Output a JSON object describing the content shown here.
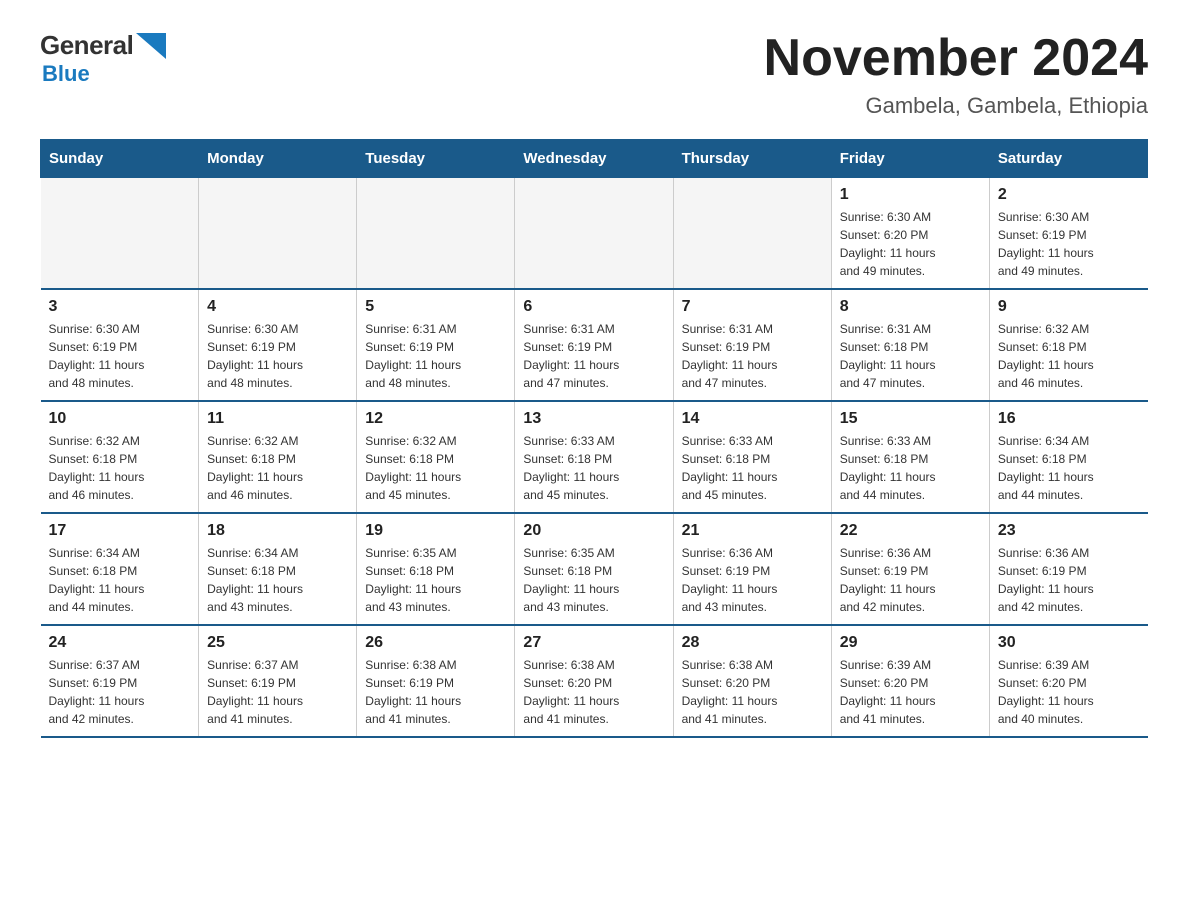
{
  "header": {
    "logo_general": "General",
    "logo_blue": "Blue",
    "title": "November 2024",
    "subtitle": "Gambela, Gambela, Ethiopia"
  },
  "weekdays": [
    "Sunday",
    "Monday",
    "Tuesday",
    "Wednesday",
    "Thursday",
    "Friday",
    "Saturday"
  ],
  "weeks": [
    [
      {
        "day": "",
        "info": ""
      },
      {
        "day": "",
        "info": ""
      },
      {
        "day": "",
        "info": ""
      },
      {
        "day": "",
        "info": ""
      },
      {
        "day": "",
        "info": ""
      },
      {
        "day": "1",
        "info": "Sunrise: 6:30 AM\nSunset: 6:20 PM\nDaylight: 11 hours\nand 49 minutes."
      },
      {
        "day": "2",
        "info": "Sunrise: 6:30 AM\nSunset: 6:19 PM\nDaylight: 11 hours\nand 49 minutes."
      }
    ],
    [
      {
        "day": "3",
        "info": "Sunrise: 6:30 AM\nSunset: 6:19 PM\nDaylight: 11 hours\nand 48 minutes."
      },
      {
        "day": "4",
        "info": "Sunrise: 6:30 AM\nSunset: 6:19 PM\nDaylight: 11 hours\nand 48 minutes."
      },
      {
        "day": "5",
        "info": "Sunrise: 6:31 AM\nSunset: 6:19 PM\nDaylight: 11 hours\nand 48 minutes."
      },
      {
        "day": "6",
        "info": "Sunrise: 6:31 AM\nSunset: 6:19 PM\nDaylight: 11 hours\nand 47 minutes."
      },
      {
        "day": "7",
        "info": "Sunrise: 6:31 AM\nSunset: 6:19 PM\nDaylight: 11 hours\nand 47 minutes."
      },
      {
        "day": "8",
        "info": "Sunrise: 6:31 AM\nSunset: 6:18 PM\nDaylight: 11 hours\nand 47 minutes."
      },
      {
        "day": "9",
        "info": "Sunrise: 6:32 AM\nSunset: 6:18 PM\nDaylight: 11 hours\nand 46 minutes."
      }
    ],
    [
      {
        "day": "10",
        "info": "Sunrise: 6:32 AM\nSunset: 6:18 PM\nDaylight: 11 hours\nand 46 minutes."
      },
      {
        "day": "11",
        "info": "Sunrise: 6:32 AM\nSunset: 6:18 PM\nDaylight: 11 hours\nand 46 minutes."
      },
      {
        "day": "12",
        "info": "Sunrise: 6:32 AM\nSunset: 6:18 PM\nDaylight: 11 hours\nand 45 minutes."
      },
      {
        "day": "13",
        "info": "Sunrise: 6:33 AM\nSunset: 6:18 PM\nDaylight: 11 hours\nand 45 minutes."
      },
      {
        "day": "14",
        "info": "Sunrise: 6:33 AM\nSunset: 6:18 PM\nDaylight: 11 hours\nand 45 minutes."
      },
      {
        "day": "15",
        "info": "Sunrise: 6:33 AM\nSunset: 6:18 PM\nDaylight: 11 hours\nand 44 minutes."
      },
      {
        "day": "16",
        "info": "Sunrise: 6:34 AM\nSunset: 6:18 PM\nDaylight: 11 hours\nand 44 minutes."
      }
    ],
    [
      {
        "day": "17",
        "info": "Sunrise: 6:34 AM\nSunset: 6:18 PM\nDaylight: 11 hours\nand 44 minutes."
      },
      {
        "day": "18",
        "info": "Sunrise: 6:34 AM\nSunset: 6:18 PM\nDaylight: 11 hours\nand 43 minutes."
      },
      {
        "day": "19",
        "info": "Sunrise: 6:35 AM\nSunset: 6:18 PM\nDaylight: 11 hours\nand 43 minutes."
      },
      {
        "day": "20",
        "info": "Sunrise: 6:35 AM\nSunset: 6:18 PM\nDaylight: 11 hours\nand 43 minutes."
      },
      {
        "day": "21",
        "info": "Sunrise: 6:36 AM\nSunset: 6:19 PM\nDaylight: 11 hours\nand 43 minutes."
      },
      {
        "day": "22",
        "info": "Sunrise: 6:36 AM\nSunset: 6:19 PM\nDaylight: 11 hours\nand 42 minutes."
      },
      {
        "day": "23",
        "info": "Sunrise: 6:36 AM\nSunset: 6:19 PM\nDaylight: 11 hours\nand 42 minutes."
      }
    ],
    [
      {
        "day": "24",
        "info": "Sunrise: 6:37 AM\nSunset: 6:19 PM\nDaylight: 11 hours\nand 42 minutes."
      },
      {
        "day": "25",
        "info": "Sunrise: 6:37 AM\nSunset: 6:19 PM\nDaylight: 11 hours\nand 41 minutes."
      },
      {
        "day": "26",
        "info": "Sunrise: 6:38 AM\nSunset: 6:19 PM\nDaylight: 11 hours\nand 41 minutes."
      },
      {
        "day": "27",
        "info": "Sunrise: 6:38 AM\nSunset: 6:20 PM\nDaylight: 11 hours\nand 41 minutes."
      },
      {
        "day": "28",
        "info": "Sunrise: 6:38 AM\nSunset: 6:20 PM\nDaylight: 11 hours\nand 41 minutes."
      },
      {
        "day": "29",
        "info": "Sunrise: 6:39 AM\nSunset: 6:20 PM\nDaylight: 11 hours\nand 41 minutes."
      },
      {
        "day": "30",
        "info": "Sunrise: 6:39 AM\nSunset: 6:20 PM\nDaylight: 11 hours\nand 40 minutes."
      }
    ]
  ]
}
